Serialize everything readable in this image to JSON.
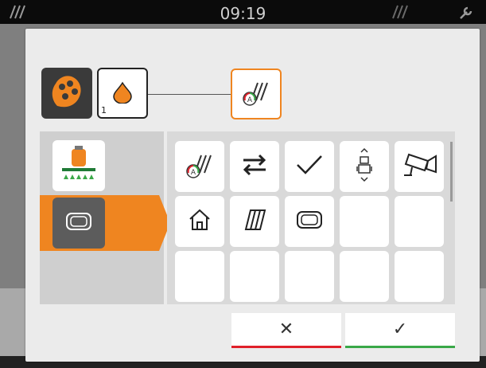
{
  "status_bar": {
    "time": "09:19",
    "left_icon": "field-lines-icon",
    "right_icons": [
      "implement-lines-icon",
      "wrench-icon"
    ]
  },
  "dialog": {
    "header": {
      "operator_icon": "operator-hand-icon",
      "selected_function_icon": "drop-icon",
      "selected_function_index": "1",
      "assigned_function_icon": "auto-field-lines-icon"
    },
    "categories": [
      {
        "name": "sprayer-category",
        "icon": "sprayer-icon",
        "selected": false
      },
      {
        "name": "screen-category",
        "icon": "screen-frame-icon",
        "selected": true
      }
    ],
    "grid_cells": [
      {
        "icon": "auto-field-lines-icon"
      },
      {
        "icon": "swap-arrows-icon"
      },
      {
        "icon": "checkmark-icon"
      },
      {
        "icon": "tractor-updown-icon"
      },
      {
        "icon": "camera-icon"
      },
      {
        "icon": "home-icon"
      },
      {
        "icon": "field-lines-icon"
      },
      {
        "icon": "screen-frame-icon"
      },
      {
        "icon": ""
      },
      {
        "icon": ""
      },
      {
        "icon": ""
      },
      {
        "icon": ""
      },
      {
        "icon": ""
      },
      {
        "icon": ""
      },
      {
        "icon": ""
      }
    ],
    "buttons": {
      "cancel_symbol": "✕",
      "confirm_symbol": "✓"
    }
  },
  "colors": {
    "accent_orange": "#ef8520",
    "cancel_red": "#e0202a",
    "confirm_green": "#3aa848"
  }
}
